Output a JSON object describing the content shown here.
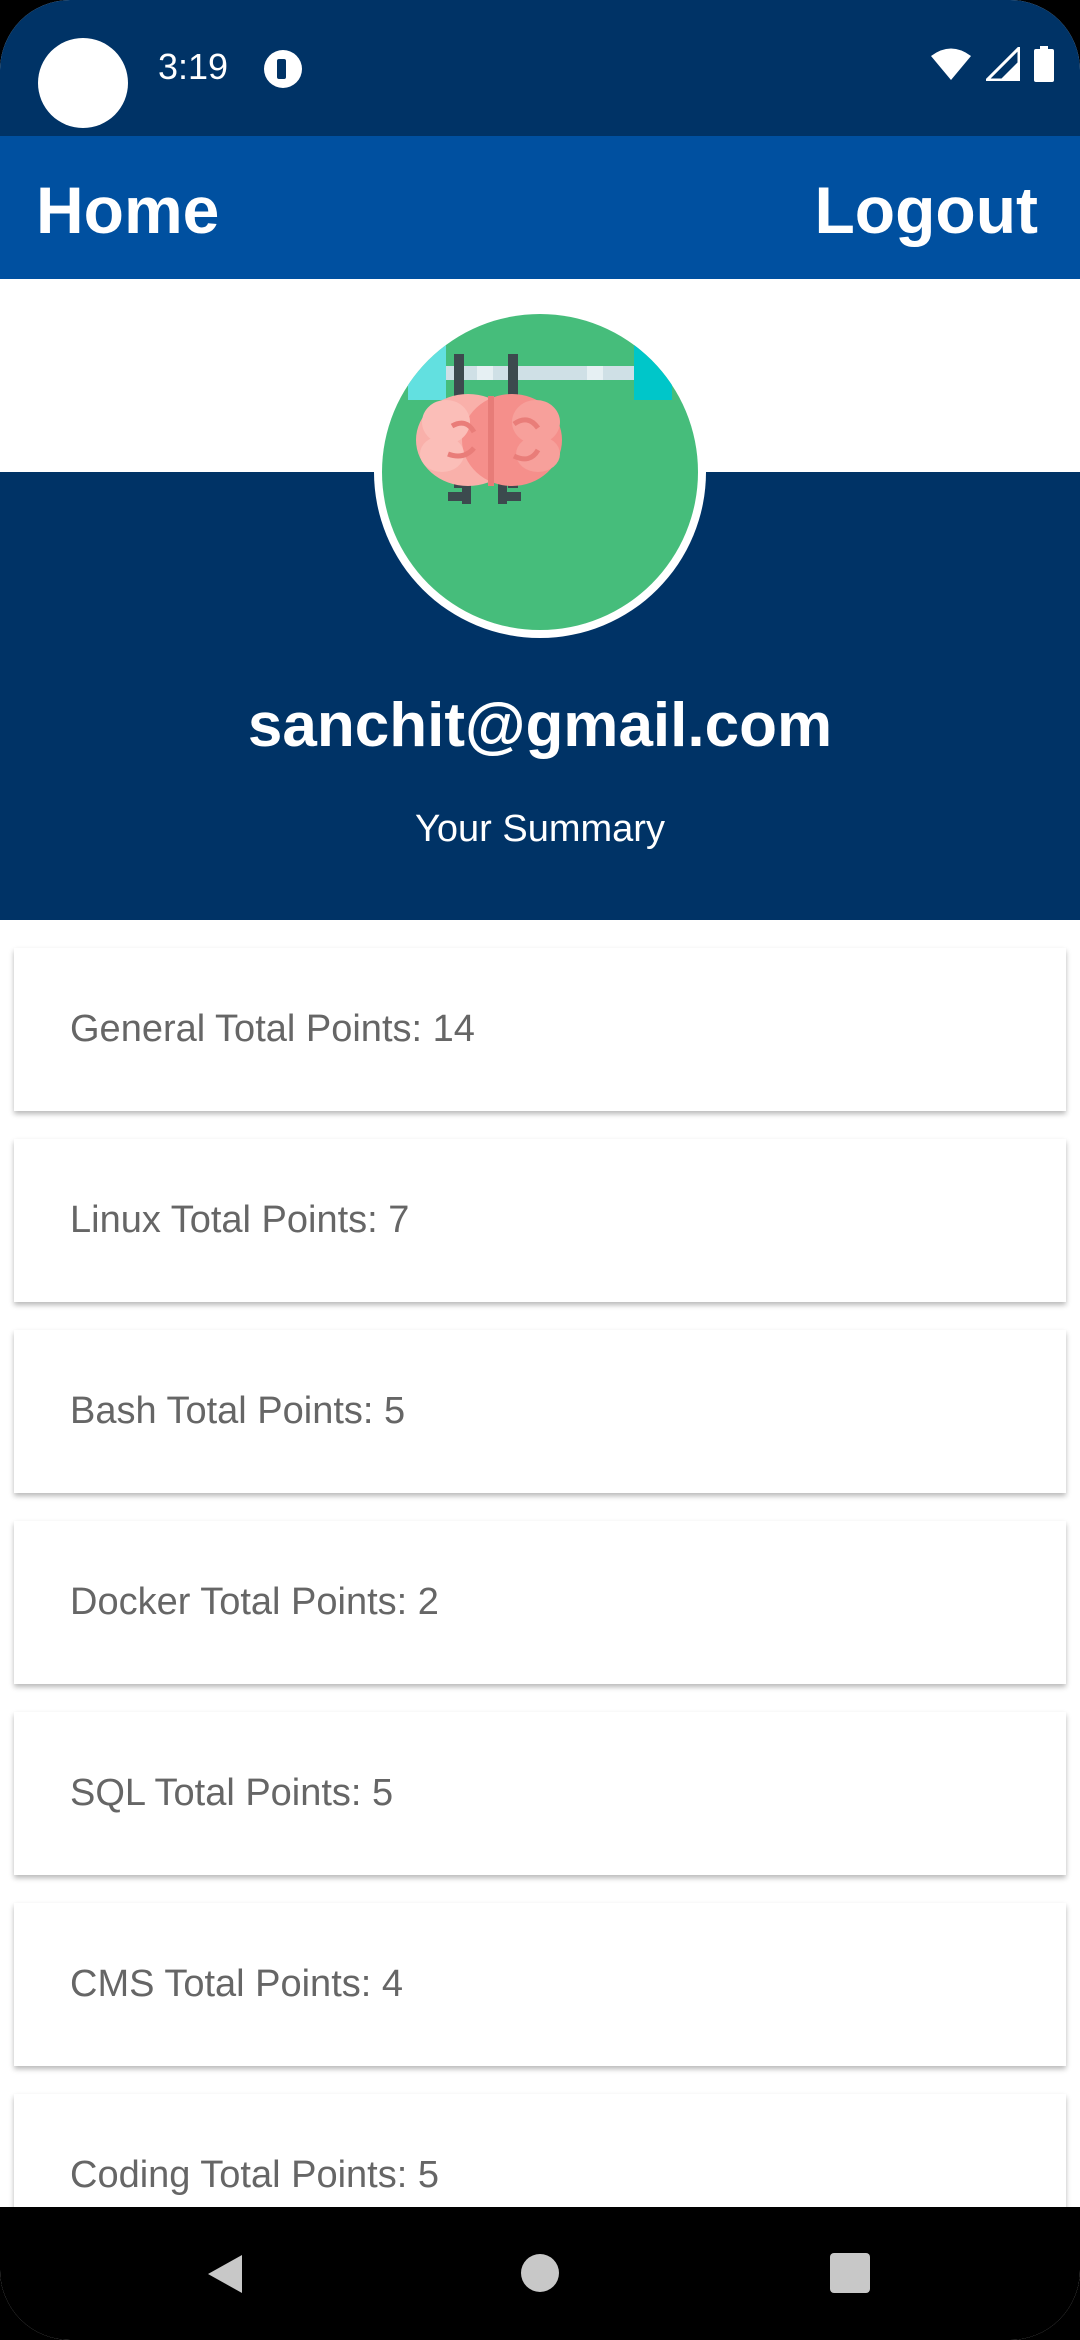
{
  "status_bar": {
    "time": "3:19"
  },
  "app_bar": {
    "home_label": "Home",
    "logout_label": "Logout"
  },
  "profile": {
    "email": "sanchit@gmail.com",
    "subtitle": "Your Summary"
  },
  "cards": [
    "General Total Points: 14",
    "Linux Total Points: 7",
    "Bash Total Points: 5",
    "Docker Total Points: 2",
    "SQL Total Points: 5",
    "CMS Total Points: 4",
    "Coding Total Points: 5"
  ],
  "icons": {
    "status": [
      "wifi-icon",
      "signal-icon",
      "battery-icon"
    ],
    "nav": [
      "back-icon",
      "home-icon",
      "recents-icon"
    ],
    "avatar": "brain-barbell-icon"
  },
  "colors": {
    "primary": "#0050a0",
    "primary_dark": "#003366",
    "avatar_bg": "#46bd7b"
  }
}
